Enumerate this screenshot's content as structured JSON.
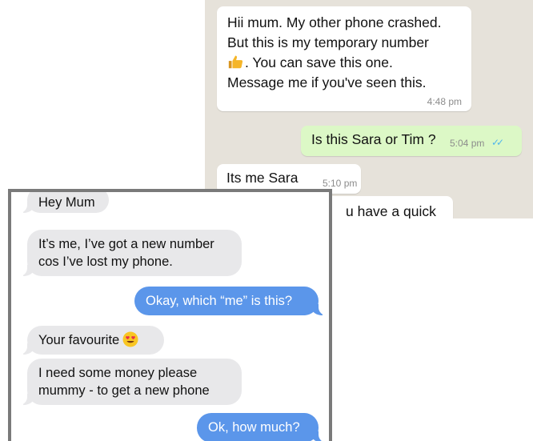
{
  "whatsapp": {
    "messages": [
      {
        "line1": "Hii mum. My other phone crashed.",
        "line2": "But this is my temporary number",
        "line3": ". You can save this one.",
        "line4": "Message me if you've seen this.",
        "time": "4:48 pm",
        "emoji": "thumbs-up-icon"
      },
      {
        "text": "Is this Sara or Tim ?",
        "time": "5:04 pm"
      },
      {
        "text": "Its me Sara",
        "time": "5:10 pm"
      },
      {
        "partial": "u have a quick"
      }
    ]
  },
  "imessage": {
    "messages": [
      {
        "text": "Hey Mum"
      },
      {
        "line1": "It’s me, I’ve got a new number",
        "line2": "cos I’ve lost my phone."
      },
      {
        "text": "Okay, which “me” is this?"
      },
      {
        "text": "Your favourite",
        "emoji": "heart-eyes-emoji-icon"
      },
      {
        "line1": "I need some money please",
        "line2": "mummy - to get a new phone"
      },
      {
        "text": "Ok, how much?"
      }
    ]
  },
  "colors": {
    "whatsapp_bg": "#e6e2da",
    "whatsapp_in": "#ffffff",
    "whatsapp_out": "#dcf8c6",
    "imessage_in": "#e8e8ea",
    "imessage_out": "#5b96ea",
    "read_ticks": "#4fb6ec"
  }
}
